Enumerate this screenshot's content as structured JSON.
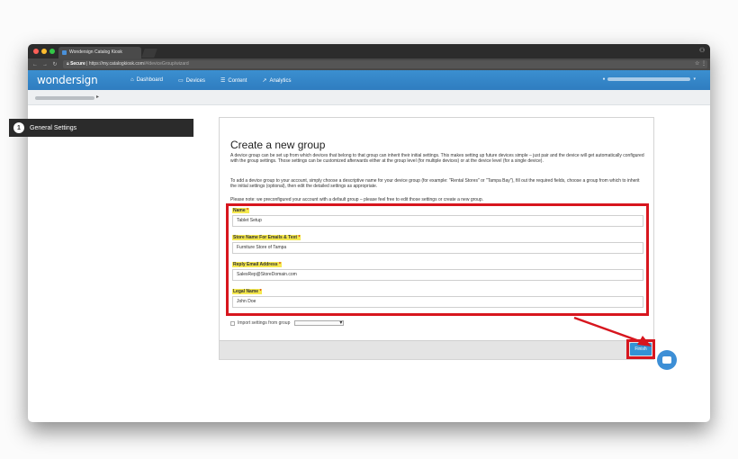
{
  "browser": {
    "tab_title": "Wondersign Catalog Kiosk",
    "url_secure": "Secure",
    "url_host": "https://my.catalogkiosk.com",
    "url_path": "/#/deviceGroup/wizard"
  },
  "header": {
    "logo": "wondersign",
    "nav": [
      {
        "label": "Dashboard",
        "icon": "home-icon"
      },
      {
        "label": "Devices",
        "icon": "monitor-icon"
      },
      {
        "label": "Content",
        "icon": "list-icon"
      },
      {
        "label": "Analytics",
        "icon": "chart-icon"
      }
    ],
    "account_icon": "user-icon"
  },
  "breadcrumb": {
    "separator": "▸"
  },
  "sidebar": {
    "step_number": "1",
    "step_label": "General Settings"
  },
  "main": {
    "title": "Create a new group",
    "para1": "A device group can be set up from which devices that belong to that group can inherit their initial settings. This makes setting up future devices simple – just pair and the device will get automatically configured with the group settings. Those settings can be customized afterwards either at the group level (for multiple devices) or at the device level (for a single device).",
    "para2": "To add a device group to your account, simply choose a descriptive name for your device group (for example: \"Rental Stores\" or \"Tampa Bay\"), fill out the required fields, choose a group from which to inherit the initial settings (optional), then edit the detailed settings as appropriate.",
    "para3": "Please note: we preconfigured your account with a default group – please feel free to edit those settings or create a new group.",
    "fields": [
      {
        "label": "Name",
        "value": "Tablet Setup"
      },
      {
        "label": "Store Name For Emails & Text",
        "value": "Furniture Store of Tampa"
      },
      {
        "label": "Reply Email Address",
        "value": "SalesRep@StoreDomain.com"
      },
      {
        "label": "Legal Name",
        "value": "John Doe"
      }
    ],
    "required_mark": "*",
    "import_label": "Import settings from group",
    "finish_label": "Finish"
  },
  "colors": {
    "accent": "#2f7dc0",
    "highlight": "#d7161e",
    "label_bg": "#f5e84e"
  }
}
